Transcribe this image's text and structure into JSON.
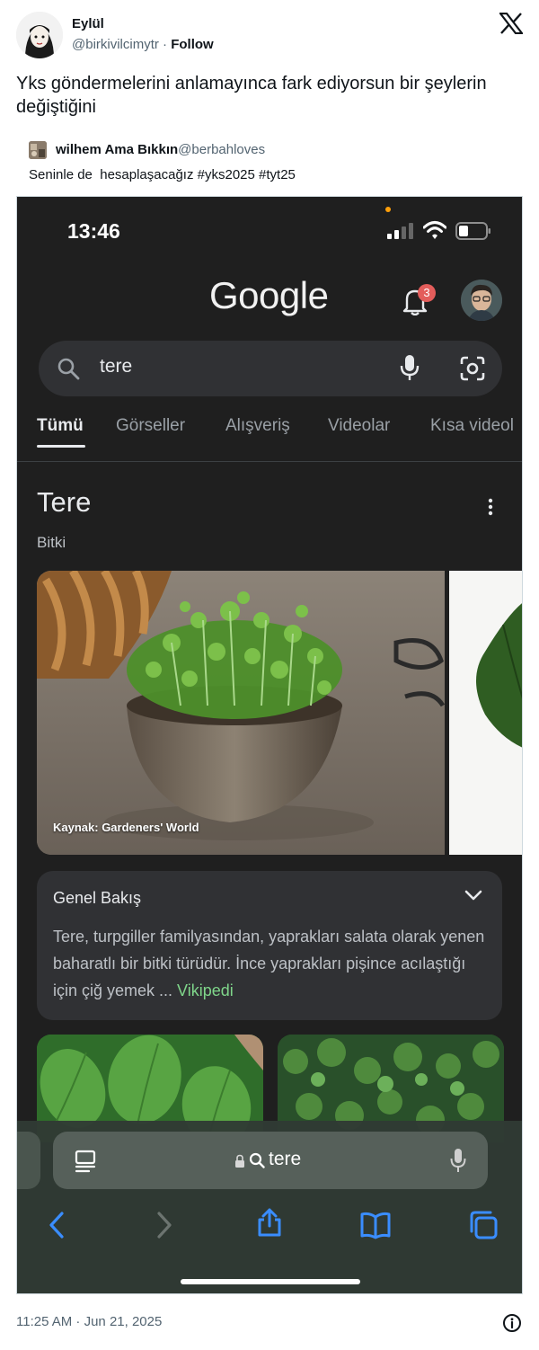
{
  "tweet": {
    "author_name": "Eylül",
    "author_handle": "@birkivilcimytr",
    "separator": " · ",
    "follow_label": "Follow",
    "text": "Yks göndermelerini anlamayınca fark ediyorsun bir şeylerin değiştiğini",
    "timestamp": "11:25 AM · Jun 21, 2025"
  },
  "quote": {
    "author_name": "wilhem Ama Bıkkın",
    "author_handle": "@berbahloves",
    "text": "Seninle de  hesaplaşacağız #yks2025 #tyt25"
  },
  "phone": {
    "status_time": "13:46",
    "google_logo": "Google",
    "notification_count": "3",
    "search_query": "tere",
    "tabs": [
      {
        "label": "Tümü",
        "active": true
      },
      {
        "label": "Görseller"
      },
      {
        "label": "Alışveriş"
      },
      {
        "label": "Videolar"
      },
      {
        "label": "Kısa videol"
      }
    ],
    "knowledge_panel": {
      "title": "Tere",
      "subtitle": "Bitki",
      "image_caption": "Kaynak: Gardeners' World"
    },
    "overview": {
      "title": "Genel Bakış",
      "text": "Tere, turpgiller familyasından, yaprakları salata olarak yenen baharatlı bir bitki türüdür. İnce yaprakları pişince acılaştığı için çiğ yemek ... ",
      "link": "Vikipedi"
    },
    "address_bar": {
      "text": "tere"
    }
  },
  "colors": {
    "screen_bg": "#1f1f1f",
    "search_bg": "#303134",
    "link_green": "#7fd58a",
    "ios_blue": "#3a8dff",
    "badge_red": "#e35d5b"
  }
}
